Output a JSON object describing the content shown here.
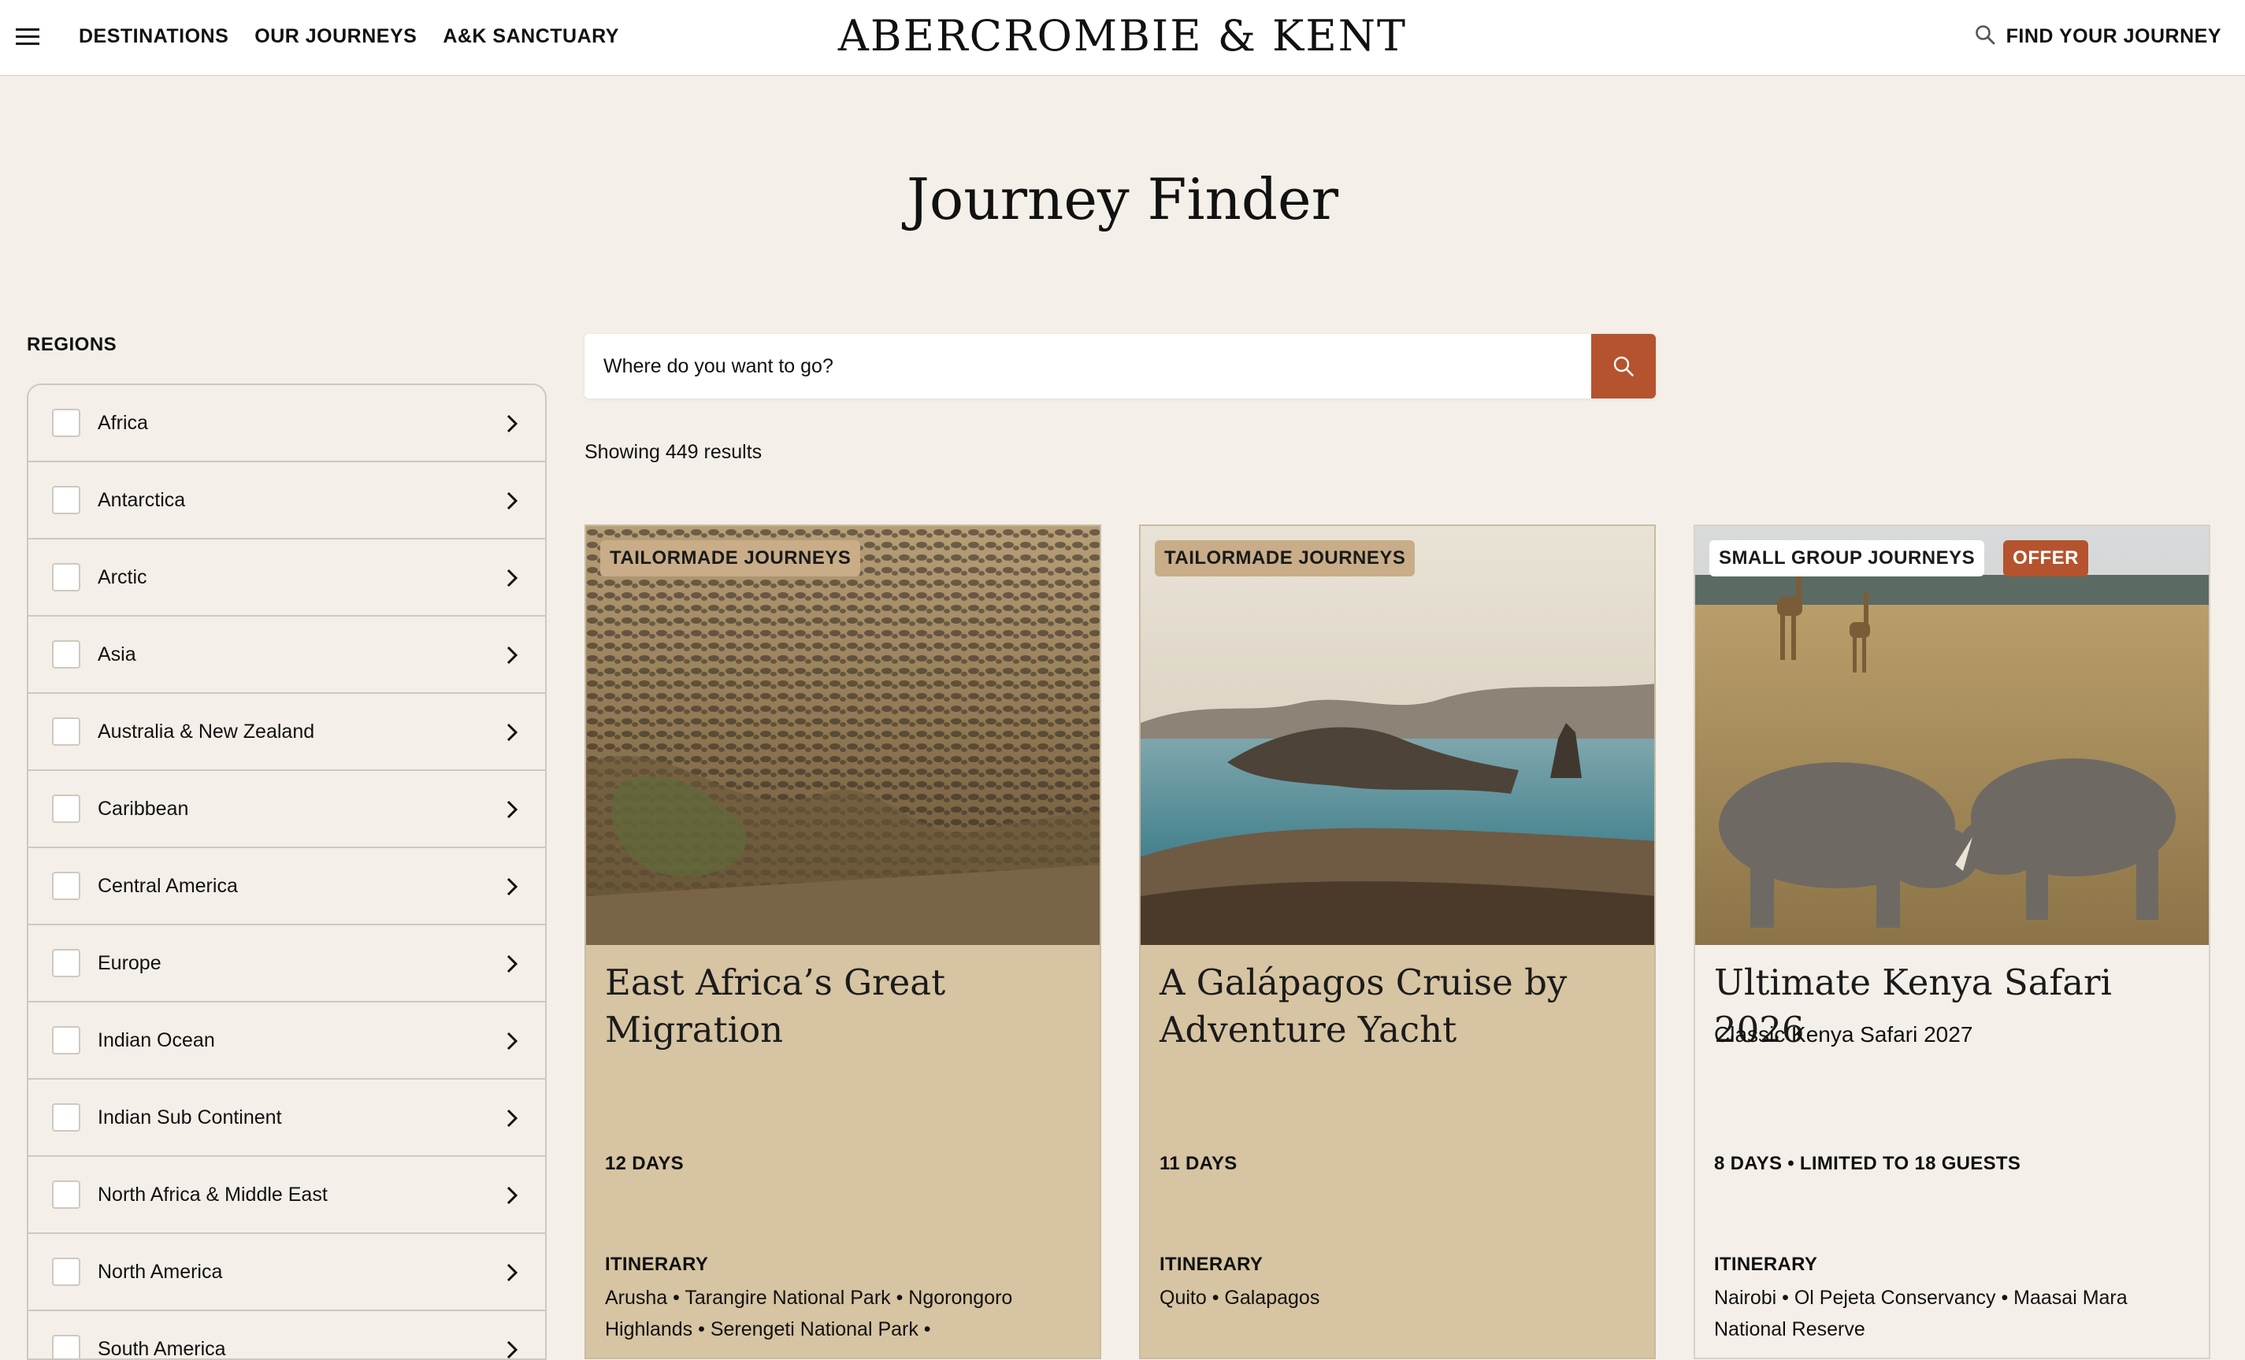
{
  "header": {
    "menu_icon": "hamburger-icon",
    "nav": [
      "DESTINATIONS",
      "OUR JOURNEYS",
      "A&K SANCTUARY"
    ],
    "logo": "ABERCROMBIE & KENT",
    "find_label": "FIND YOUR JOURNEY",
    "find_icon": "search-icon"
  },
  "page": {
    "title": "Journey Finder"
  },
  "sidebar": {
    "heading": "REGIONS",
    "regions": [
      "Africa",
      "Antarctica",
      "Arctic",
      "Asia",
      "Australia & New Zealand",
      "Caribbean",
      "Central America",
      "Europe",
      "Indian Ocean",
      "Indian Sub Continent",
      "North Africa & Middle East",
      "North America",
      "South America"
    ]
  },
  "search": {
    "placeholder": "Where do you want to go?",
    "button_icon": "search-icon",
    "accent": "#b5532e"
  },
  "results": {
    "count_text": "Showing 449 results"
  },
  "cards": [
    {
      "badges": [
        "TAILORMADE JOURNEYS"
      ],
      "title": "East Africa’s Great Migration",
      "subtitle": "",
      "duration": "12 DAYS",
      "itinerary_label": "ITINERARY",
      "itinerary": "Arusha • Tarangire National Park • Ngorongoro Highlands • Serengeti National Park •",
      "background": "#d6c4a2"
    },
    {
      "badges": [
        "TAILORMADE JOURNEYS"
      ],
      "title": "A Galápagos Cruise by Adventure Yacht",
      "subtitle": "",
      "duration": "11 DAYS",
      "itinerary_label": "ITINERARY",
      "itinerary": "Quito • Galapagos",
      "background": "#d6c4a2"
    },
    {
      "badges": [
        "SMALL GROUP JOURNEYS",
        "OFFER"
      ],
      "title": "Ultimate Kenya Safari 2026",
      "subtitle": "Classic Kenya Safari 2027",
      "duration": "8 DAYS • LIMITED TO 18 GUESTS",
      "itinerary_label": "ITINERARY",
      "itinerary": "Nairobi • Ol Pejeta Conservancy • Maasai Mara National Reserve",
      "background": "#f4efe8"
    }
  ]
}
